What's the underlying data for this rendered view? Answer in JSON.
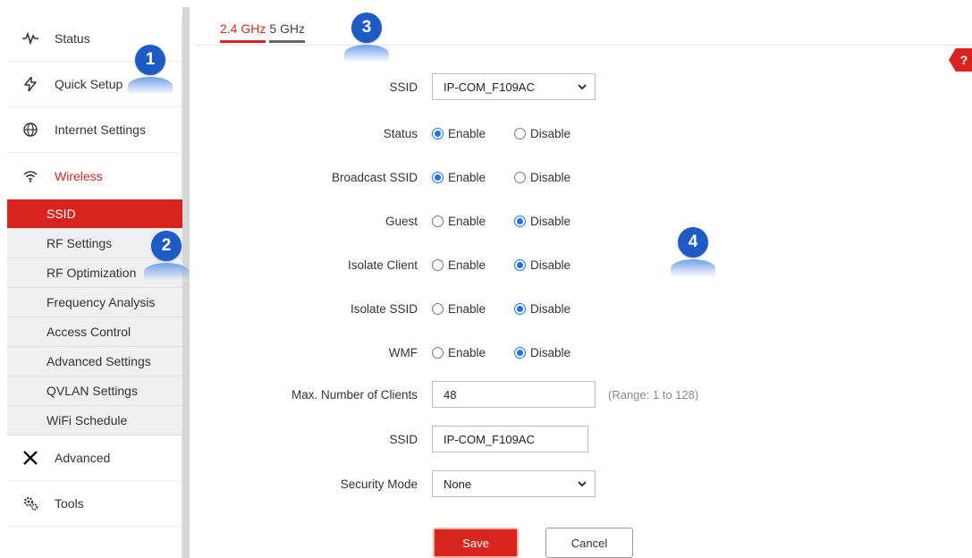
{
  "sidebar": {
    "items": [
      {
        "label": "Status",
        "icon": "pulse-icon"
      },
      {
        "label": "Quick Setup",
        "icon": "bolt-icon"
      },
      {
        "label": "Internet Settings",
        "icon": "globe-icon"
      },
      {
        "label": "Wireless",
        "icon": "wifi-icon"
      },
      {
        "label": "Advanced",
        "icon": "tools-cross-icon"
      },
      {
        "label": "Tools",
        "icon": "gears-icon"
      }
    ],
    "submenu": [
      "SSID",
      "RF Settings",
      "RF Optimization",
      "Frequency Analysis",
      "Access Control",
      "Advanced Settings",
      "QVLAN Settings",
      "WiFi Schedule"
    ]
  },
  "tabs": [
    "2.4 GHz",
    "5 GHz"
  ],
  "help_label": "?",
  "form": {
    "ssid_select": {
      "label": "SSID",
      "value": "IP-COM_F109AC"
    },
    "radio_options": {
      "enable": "Enable",
      "disable": "Disable"
    },
    "radios": [
      {
        "label": "Status",
        "selected": "Enable"
      },
      {
        "label": "Broadcast SSID",
        "selected": "Enable"
      },
      {
        "label": "Guest",
        "selected": "Disable"
      },
      {
        "label": "Isolate Client",
        "selected": "Disable"
      },
      {
        "label": "Isolate SSID",
        "selected": "Disable"
      },
      {
        "label": "WMF",
        "selected": "Disable"
      }
    ],
    "max_clients": {
      "label": "Max. Number of Clients",
      "value": "48",
      "range": "(Range: 1 to 128)"
    },
    "ssid_input": {
      "label": "SSID",
      "value": "IP-COM_F109AC"
    },
    "security_mode": {
      "label": "Security Mode",
      "value": "None"
    },
    "save_label": "Save",
    "cancel_label": "Cancel"
  },
  "callouts": [
    "1",
    "2",
    "3",
    "4"
  ],
  "colors": {
    "accent": "#d7241f",
    "radio": "#1a73e8",
    "callout": "#1f5bc5"
  }
}
